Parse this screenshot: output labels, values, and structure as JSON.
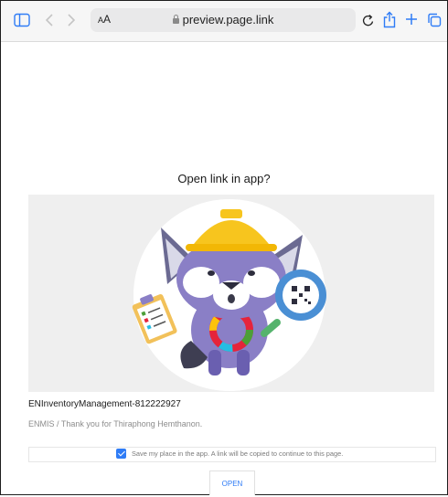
{
  "browser": {
    "text_size_label": "AA",
    "url": "preview.page.link",
    "accent_color": "#2f7cf6",
    "icons": [
      "sidebar-icon",
      "back-icon",
      "forward-icon",
      "lock-icon",
      "reload-icon",
      "share-icon",
      "new-tab-icon",
      "tabs-icon"
    ]
  },
  "prompt": {
    "title": "Open link in app?",
    "app_name": "ENInventoryManagement-812222927",
    "description": "ENMIS / Thank you for Thiraphong Hemthanon.",
    "save_label": "Save my place in the app. A link will be copied to continue to this page.",
    "save_checked": true,
    "open_label": "OPEN"
  }
}
